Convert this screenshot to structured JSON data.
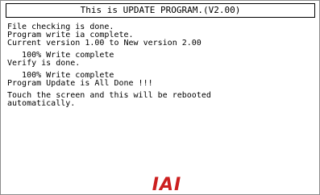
{
  "screen": {
    "title": "This is UPDATE PROGRAM.(V2.00)",
    "log_groups": [
      [
        "File checking is done.",
        "Program write ia complete.",
        "Current version 1.00 to New version 2.00"
      ],
      [
        "   100% Write complete",
        "Verify is done."
      ],
      [
        "   100% Write complete",
        "Program Update is All Done !!!"
      ],
      [
        "Touch the screen and this will be rebooted",
        "automatically."
      ]
    ],
    "logo_text": "IAI"
  },
  "colors": {
    "background": "#ffffff",
    "text": "#000000",
    "logo": "#cc1f1f",
    "frame": "#8c8c8c"
  }
}
